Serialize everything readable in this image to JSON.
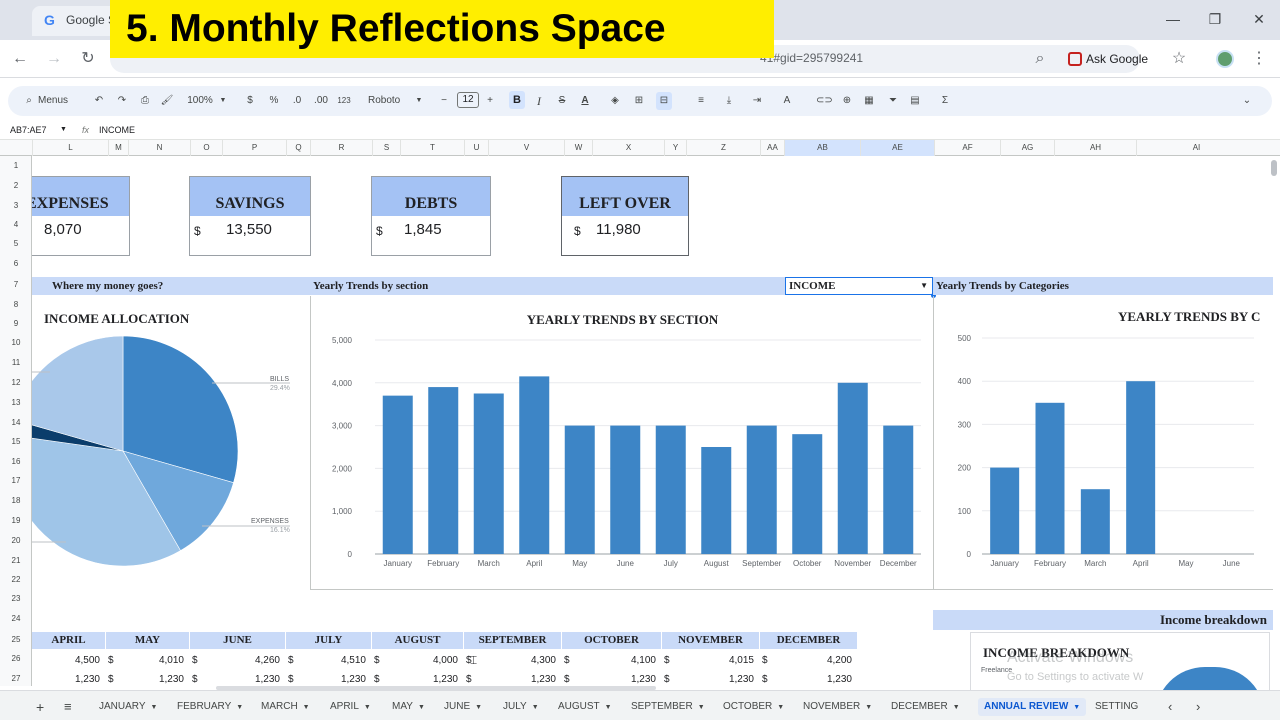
{
  "banner": "5. Monthly Reflections Space",
  "browser": {
    "tab_title": "Google S",
    "url_fragment": "41#gid=295799241",
    "ask_google": "Ask Google"
  },
  "toolbar": {
    "menus": "Menus",
    "zoom": "100%",
    "currency": "$",
    "percent": "%",
    "dec_less": ".0",
    "dec_more": ".00",
    "number_format": "123",
    "font": "Roboto",
    "font_size": "12",
    "bold": "B",
    "italic": "I",
    "sigma": "Σ"
  },
  "formula_bar": {
    "cell_ref": "AB7:AE7",
    "fx": "fx",
    "content": "INCOME"
  },
  "columns": [
    "L",
    "M",
    "N",
    "O",
    "P",
    "Q",
    "R",
    "S",
    "T",
    "U",
    "V",
    "W",
    "X",
    "Y",
    "Z",
    "AA",
    "AB",
    "AE",
    "AF",
    "AG",
    "AH",
    "AI"
  ],
  "rows": [
    "1",
    "2",
    "3",
    "4",
    "5",
    "6",
    "7",
    "8",
    "9",
    "10",
    "11",
    "12",
    "13",
    "14",
    "15",
    "16",
    "17",
    "18",
    "19",
    "20",
    "21",
    "22",
    "23",
    "24",
    "25",
    "26",
    "27"
  ],
  "cards": [
    {
      "label": "EXPENSES",
      "value": "8,070",
      "currency": ""
    },
    {
      "label": "SAVINGS",
      "value": "13,550",
      "currency": "$"
    },
    {
      "label": "DEBTS",
      "value": "1,845",
      "currency": "$"
    },
    {
      "label": "LEFT OVER",
      "value": "11,980",
      "currency": "$"
    }
  ],
  "sections": {
    "where_money": "Where my money goes?",
    "yearly_section": "Yearly  Trends by section",
    "income_select": "INCOME",
    "yearly_categories": "Yearly  Trends by Categories"
  },
  "chart_data": [
    {
      "type": "pie",
      "title": "INCOME ALLOCATION",
      "labels": [
        "BILLS",
        "EXPENSES"
      ],
      "label_values": [
        "29.4%",
        "16.1%"
      ],
      "colors": [
        "#3d85c6",
        "#6fa8dc",
        "#9fc5e8",
        "#0b3d6b",
        "#a9c8ea"
      ]
    },
    {
      "type": "bar",
      "title": "YEARLY TRENDS BY SECTION",
      "categories": [
        "January",
        "February",
        "March",
        "April",
        "May",
        "June",
        "July",
        "August",
        "September",
        "October",
        "November",
        "December"
      ],
      "values": [
        3700,
        3900,
        3750,
        4150,
        3000,
        3000,
        3000,
        2500,
        3000,
        2800,
        4000,
        3000
      ],
      "ylim": [
        0,
        5000
      ],
      "yticks": [
        "0",
        "1,000",
        "2,000",
        "3,000",
        "4,000",
        "5,000"
      ],
      "color": "#3d85c6"
    },
    {
      "type": "bar",
      "title": "YEARLY TRENDS BY C",
      "categories": [
        "January",
        "February",
        "March",
        "April",
        "May",
        "June"
      ],
      "values": [
        200,
        350,
        150,
        400,
        0,
        0
      ],
      "ylim": [
        0,
        500
      ],
      "yticks": [
        "0",
        "100",
        "200",
        "300",
        "400",
        "500"
      ],
      "color": "#3d85c6"
    }
  ],
  "months_table": {
    "headers": [
      "APRIL",
      "MAY",
      "JUNE",
      "JULY",
      "AUGUST",
      "SEPTEMBER",
      "OCTOBER",
      "NOVEMBER",
      "DECEMBER"
    ],
    "row1": [
      "4,500",
      "4,010",
      "4,260",
      "4,510",
      "4,000",
      "4,300",
      "4,100",
      "4,015",
      "4,200"
    ],
    "row2": [
      "1,230",
      "1,230",
      "1,230",
      "1,230",
      "1,230",
      "1,230",
      "1,230",
      "1,230",
      "1,230"
    ]
  },
  "income_breakdown": {
    "header": "Income breakdown",
    "title": "INCOME BREAKDOWN",
    "item": "Freelance",
    "watermark_1": "Activate Windows",
    "watermark_2": "Go to Settings to activate W"
  },
  "sheet_tabs": [
    "JANUARY",
    "FEBRUARY",
    "MARCH",
    "APRIL",
    "MAY",
    "JUNE",
    "JULY",
    "AUGUST",
    "SEPTEMBER",
    "OCTOBER",
    "NOVEMBER",
    "DECEMBER",
    "ANNUAL REVIEW",
    "SETTING"
  ]
}
